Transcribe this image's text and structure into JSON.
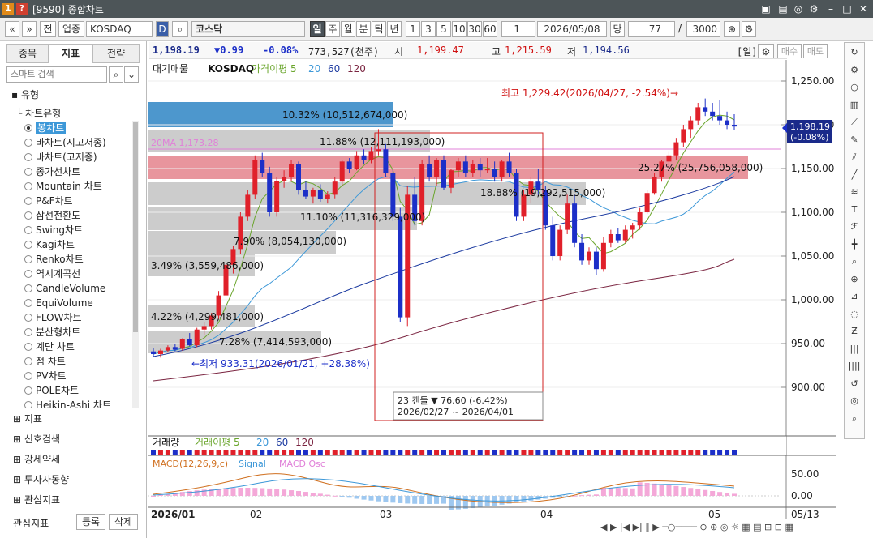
{
  "window": {
    "title": "[9590] 종합차트"
  },
  "toolbar": {
    "market": "업종",
    "symbol": "KOSDAQ",
    "name": "코스닥",
    "period_tabs": [
      "일",
      "주",
      "월",
      "분",
      "틱",
      "년"
    ],
    "counts": [
      "1",
      "3",
      "5",
      "10",
      "30",
      "60"
    ],
    "date": "2026/05/08",
    "unit": "당",
    "n1": "77",
    "sep": "/",
    "n2": "3000",
    "misc": [
      "전",
      "1"
    ]
  },
  "left": {
    "tabs": [
      "종목",
      "지표",
      "전략"
    ],
    "search_placeholder": "스마트 검색",
    "section": "유형",
    "subsection": "차트유형",
    "chart_types": [
      "봉차트",
      "바차트(시고저종)",
      "바차트(고저종)",
      "종가선차트",
      "Mountain 차트",
      "P&F차트",
      "삼선전환도",
      "Swing차트",
      "Kagi차트",
      "Renko차트",
      "역시계곡선",
      "CandleVolume",
      "EquiVolume",
      "FLOW차트",
      "분산형차트",
      "계단 차트",
      "점 차트",
      "PV차트",
      "POLE차트",
      "Heikin-Ashi 차트"
    ],
    "tree": [
      "지표",
      "신호검색",
      "강세약세",
      "투자자동향",
      "관심지표"
    ],
    "footer_label": "관심지표",
    "btn_register": "등록",
    "btn_delete": "삭제"
  },
  "quote": {
    "price": "1,198.19",
    "change": "▼0.99",
    "rate": "-0.08%",
    "volume": "773,527(천주)",
    "open_label": "시",
    "open": "1,199.47",
    "high_label": "고",
    "high": "1,215.59",
    "low_label": "저",
    "low": "1,194.56",
    "period": "[일]",
    "buy": "매수",
    "sell": "매도"
  },
  "legend": {
    "items": [
      "대기매물",
      "KOSDAQ",
      "가격이평 5",
      "20",
      "60",
      "120"
    ]
  },
  "annotations": {
    "max": "최고 1,229.42(2026/04/27, -2.54%)→",
    "min": "←최저 933.31(2026/01/21, +28.38%)",
    "ma20": "20MA 1,173.28",
    "box1": "23 캔들 ▼ 76.60 (-6.42%)",
    "box2": "2026/02/27 ~ 2026/04/01",
    "vp": [
      "10.32% (10,512,674,000)",
      "11.88% (12,111,193,000)",
      "25.27% (25,756,058,000)",
      "18.88% (19,292,515,000)",
      "11.10% (11,316,329,000)",
      "7.90% (8,054,130,000)",
      "3.49% (3,559,486,000)",
      "4.22% (4,299,481,000)",
      "7.28% (7,414,593,000)"
    ]
  },
  "yaxis": [
    "1,250.00",
    "1,200.00",
    "1,150.00",
    "1,100.00",
    "1,050.00",
    "1,000.00",
    "950.00",
    "900.00"
  ],
  "yaxis_tag": [
    "1,198.19",
    "(-0.08%)"
  ],
  "volume": {
    "items": [
      "거래량",
      "거래이평 5",
      "20",
      "60",
      "120"
    ]
  },
  "macd": {
    "items": [
      "MACD(12,26,9,c)",
      "Signal",
      "MACD Osc"
    ],
    "yaxis": [
      "50.00",
      "0.00"
    ]
  },
  "xaxis": [
    "2026/01",
    "02",
    "03",
    "04",
    "05",
    "05/13"
  ],
  "colors": {
    "up": "#e0202a",
    "down": "#1c2fc8",
    "ma5": "#6aa52c",
    "ma20": "#3d98d8",
    "ma60": "#1b3aa0",
    "ma120": "#7a2440"
  }
}
